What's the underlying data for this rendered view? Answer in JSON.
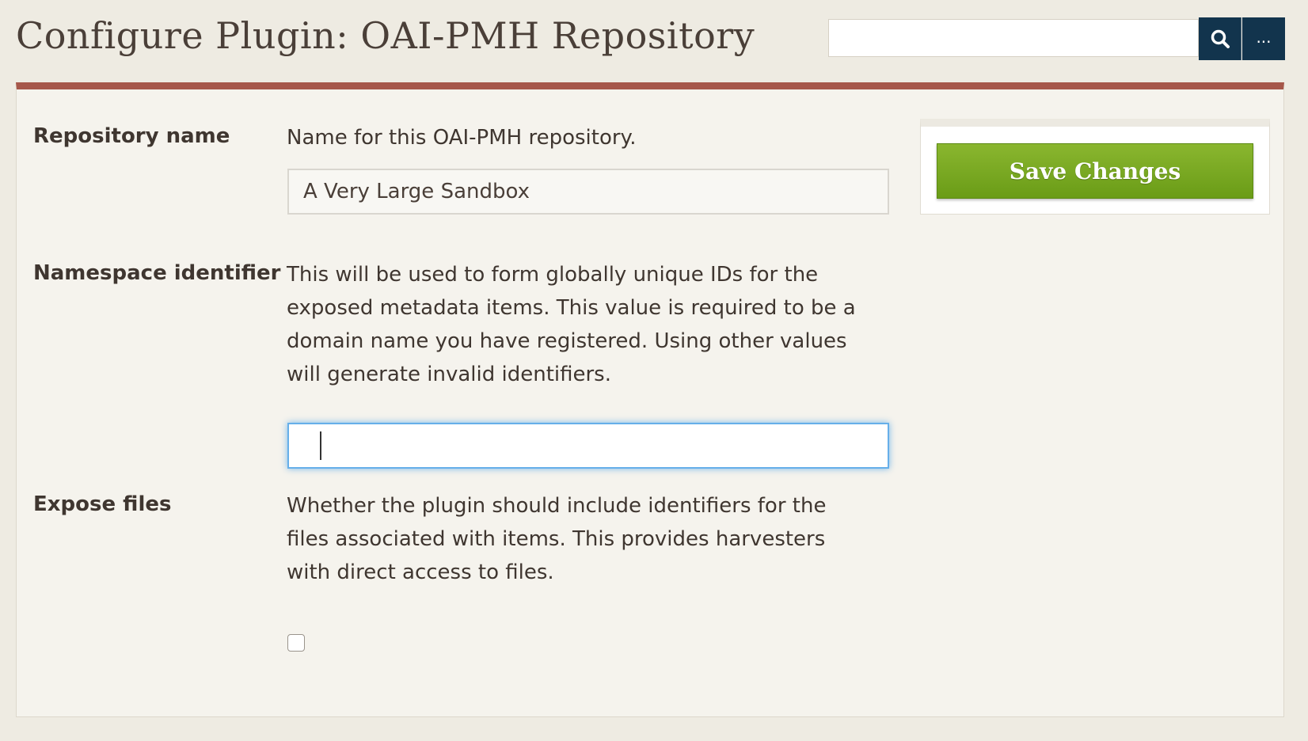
{
  "header": {
    "title": "Configure Plugin: OAI-PMH Repository",
    "search": {
      "value": "",
      "placeholder": ""
    },
    "more_label": "..."
  },
  "form": {
    "repository_name": {
      "label": "Repository name",
      "description": "Name for this OAI-PMH repository.",
      "value": "A Very Large Sandbox"
    },
    "namespace_identifier": {
      "label": "Namespace identifier",
      "description": "This will be used to form globally unique IDs for the exposed metadata items. This value is required to be a domain name you have registered. Using other values will generate invalid identifiers.",
      "value": ""
    },
    "expose_files": {
      "label": "Expose files",
      "description": "Whether the plugin should include identifiers for the files associated with items. This provides harvesters with direct access to files.",
      "checked": false
    }
  },
  "actions": {
    "save_label": "Save Changes"
  },
  "colors": {
    "accent_bar": "#a6574a",
    "save_green": "#7aa823",
    "search_button": "#12344d",
    "focus_ring": "#66afe9"
  },
  "icons": {
    "search": "search-icon"
  }
}
